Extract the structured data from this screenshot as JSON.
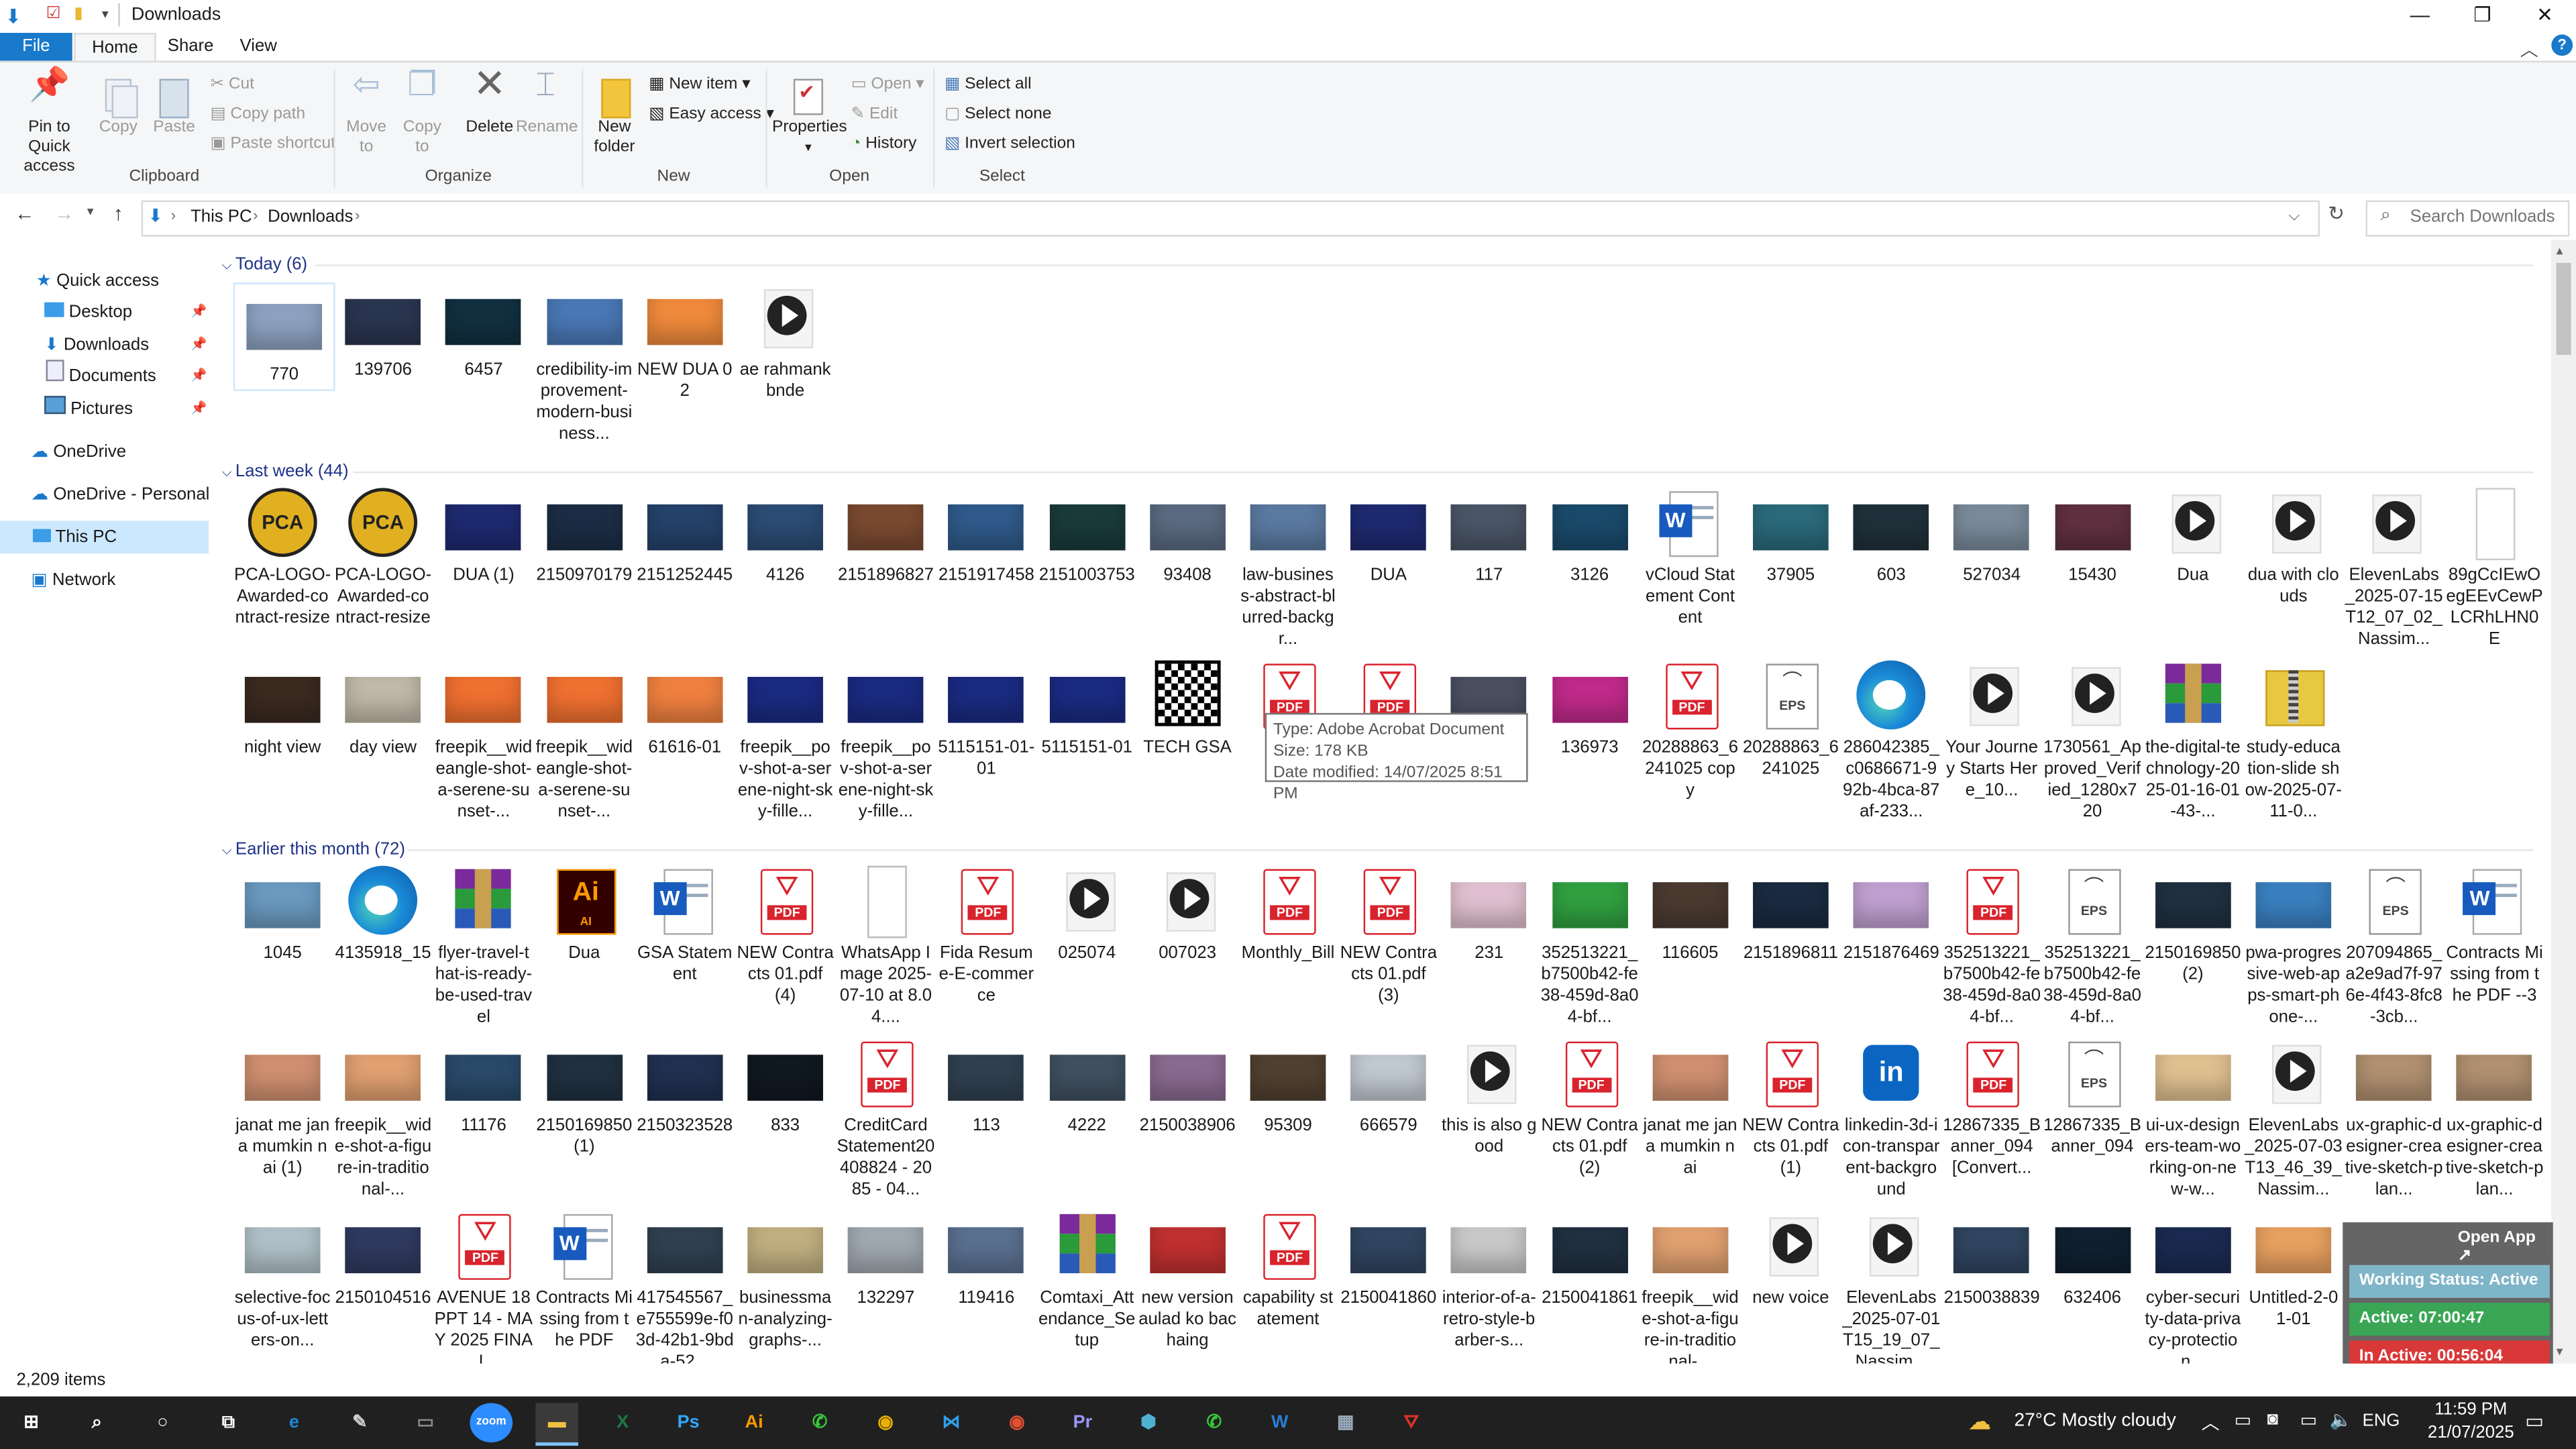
{
  "window": {
    "title": "Downloads",
    "minimize": "—",
    "maximize": "❐",
    "close": "✕"
  },
  "ribbon_tabs": [
    "File",
    "Home",
    "Share",
    "View"
  ],
  "ribbon": {
    "clipboard": {
      "label": "Clipboard",
      "pin": "Pin to Quick access",
      "copy": "Copy",
      "paste": "Paste",
      "cut": "Cut",
      "copy_path": "Copy path",
      "paste_shortcut": "Paste shortcut"
    },
    "organize": {
      "label": "Organize",
      "move_to": "Move to",
      "copy_to": "Copy to",
      "delete": "Delete",
      "rename": "Rename"
    },
    "new": {
      "label": "New",
      "new_folder": "New folder",
      "new_item": "New item",
      "easy_access": "Easy access"
    },
    "open": {
      "label": "Open",
      "properties": "Properties",
      "open": "Open",
      "edit": "Edit",
      "history": "History"
    },
    "select": {
      "label": "Select",
      "select_all": "Select all",
      "select_none": "Select none",
      "invert_selection": "Invert selection"
    }
  },
  "address": {
    "crumbs": [
      "This PC",
      "Downloads"
    ],
    "search_placeholder": "Search Downloads"
  },
  "nav": {
    "quick_access": "Quick access",
    "desktop": "Desktop",
    "downloads": "Downloads",
    "documents": "Documents",
    "pictures": "Pictures",
    "onedrive": "OneDrive",
    "onedrive_personal": "OneDrive - Personal",
    "this_pc": "This PC",
    "network": "Network"
  },
  "groups": {
    "today": "Today (6)",
    "last_week": "Last week (44)",
    "earlier": "Earlier this month (72)"
  },
  "files_today": [
    {
      "name": "770",
      "type": "photo",
      "color": "#8da2c0"
    },
    {
      "name": "139706",
      "type": "photo",
      "color": "#2a3550"
    },
    {
      "name": "6457",
      "type": "photo",
      "color": "#123040"
    },
    {
      "name": "credibility-improvement-modern-business...",
      "type": "photo",
      "color": "#4a78b5"
    },
    {
      "name": "NEW DUA 02",
      "type": "photo",
      "color": "#f08a3c"
    },
    {
      "name": "ae rahmank bnde",
      "type": "video",
      "color": "#333333"
    }
  ],
  "files_week_row1": [
    {
      "name": "PCA-LOGO-Awarded-contract-resize",
      "type": "pca",
      "color": "#e0b020"
    },
    {
      "name": "PCA-LOGO-Awarded-contract-resize",
      "type": "pca",
      "color": "#e0b020"
    },
    {
      "name": "DUA (1)",
      "type": "photo",
      "color": "#1e2a70"
    },
    {
      "name": "2150970179",
      "type": "photo",
      "color": "#1b2d45"
    },
    {
      "name": "2151252445",
      "type": "photo",
      "color": "#25426a"
    },
    {
      "name": "4126",
      "type": "photo",
      "color": "#2b4c74"
    },
    {
      "name": "2151896827",
      "type": "photo",
      "color": "#7a4a30"
    },
    {
      "name": "2151917458",
      "type": "photo",
      "color": "#2f5a8a"
    },
    {
      "name": "2151003753",
      "type": "photo",
      "color": "#1a3a3a"
    },
    {
      "name": "93408",
      "type": "photo",
      "color": "#5a6a80"
    },
    {
      "name": "law-business-abstract-blurred-backgr...",
      "type": "photo",
      "color": "#5b7aa0"
    },
    {
      "name": "DUA",
      "type": "photo",
      "color": "#1e2a70"
    },
    {
      "name": "117",
      "type": "photo",
      "color": "#4a5566"
    },
    {
      "name": "3126",
      "type": "photo",
      "color": "#1a4a6a"
    },
    {
      "name": "vCloud Statement Content",
      "type": "word",
      "color": "#185abd"
    },
    {
      "name": "37905",
      "type": "photo",
      "color": "#2a6a7a"
    },
    {
      "name": "603",
      "type": "photo",
      "color": "#20303a"
    },
    {
      "name": "527034",
      "type": "photo",
      "color": "#7a8a9a"
    },
    {
      "name": "15430",
      "type": "photo",
      "color": "#603040"
    },
    {
      "name": "Dua",
      "type": "video",
      "color": "#333333"
    },
    {
      "name": "dua with clouds",
      "type": "video",
      "color": "#333333"
    },
    {
      "name": "ElevenLabs_2025-07-15T12_07_02_Nassim...",
      "type": "video",
      "color": "#333333"
    },
    {
      "name": "89gCcIEwOegEEvCewPLCRhLHN0E",
      "type": "doc",
      "color": "#cccccc"
    }
  ],
  "files_week_row2": [
    {
      "name": "night view",
      "type": "photo",
      "color": "#3a2a20"
    },
    {
      "name": "day view",
      "type": "photo",
      "color": "#c0b8a8"
    },
    {
      "name": "freepik__wideangle-shot-a-serene-sunset-...",
      "type": "photo",
      "color": "#f07030"
    },
    {
      "name": "freepik__wideangle-shot-a-serene-sunset-...",
      "type": "photo",
      "color": "#f07030"
    },
    {
      "name": "61616-01",
      "type": "photo",
      "color": "#f08040"
    },
    {
      "name": "freepik__pov-shot-a-serene-night-sky-fille...",
      "type": "photo",
      "color": "#1a2a80"
    },
    {
      "name": "freepik__pov-shot-a-serene-night-sky-fille...",
      "type": "photo",
      "color": "#1a2a80"
    },
    {
      "name": "5115151-01-01",
      "type": "photo",
      "color": "#1a2a80"
    },
    {
      "name": "5115151-01",
      "type": "photo",
      "color": "#1a2a80"
    },
    {
      "name": "TECH GSA",
      "type": "qr",
      "color": "#000000"
    },
    {
      "name": "",
      "type": "pdf",
      "color": "#d9232d"
    },
    {
      "name": "",
      "type": "pdf",
      "color": "#d9232d"
    },
    {
      "name": "",
      "type": "photo",
      "color": "#4a5060"
    },
    {
      "name": "136973",
      "type": "photo",
      "color": "#c02a8a"
    },
    {
      "name": "20288863_6241025 copy",
      "type": "pdf",
      "color": "#d9232d"
    },
    {
      "name": "20288863_6241025",
      "type": "eps",
      "color": "#666666"
    },
    {
      "name": "286042385_c0686671-992b-4bca-87af-233...",
      "type": "edge",
      "color": "#1a8ad8"
    },
    {
      "name": "Your Journey Starts Here_10...",
      "type": "video",
      "color": "#c03020"
    },
    {
      "name": "1730561_Approved_Verified_1280x720",
      "type": "video",
      "color": "#c0a070"
    },
    {
      "name": "the-digital-technology-2025-01-16-01-43-...",
      "type": "rar",
      "color": "#a03070"
    },
    {
      "name": "study-education-slide show-2025-07-11-0...",
      "type": "zip",
      "color": "#e8c840"
    }
  ],
  "files_earlier_row1": [
    {
      "name": "1045",
      "type": "photo",
      "color": "#6a9ac0"
    },
    {
      "name": "4135918_15",
      "type": "edge",
      "color": "#1a8ad8"
    },
    {
      "name": "flyer-travel-that-is-ready-be-used-travel",
      "type": "rar",
      "color": "#a03070"
    },
    {
      "name": "Dua",
      "type": "ai",
      "color": "#330000"
    },
    {
      "name": "GSA Statement",
      "type": "word",
      "color": "#185abd"
    },
    {
      "name": "NEW Contracts 01.pdf (4)",
      "type": "pdf",
      "color": "#d9232d"
    },
    {
      "name": "WhatsApp Image 2025-07-10 at 8.04....",
      "type": "doc",
      "color": "#bbbbbb"
    },
    {
      "name": "Fida Resume-E-commerce",
      "type": "pdf",
      "color": "#d9232d"
    },
    {
      "name": "025074",
      "type": "video",
      "color": "#333333"
    },
    {
      "name": "007023",
      "type": "video",
      "color": "#333333"
    },
    {
      "name": "Monthly_Bill",
      "type": "pdf",
      "color": "#d9232d"
    },
    {
      "name": "NEW Contracts 01.pdf (3)",
      "type": "pdf",
      "color": "#d9232d"
    },
    {
      "name": "231",
      "type": "photo",
      "color": "#e0c0d0"
    },
    {
      "name": "352513221_b7500b42-fe38-459d-8a04-bf...",
      "type": "photo",
      "color": "#30a040"
    },
    {
      "name": "116605",
      "type": "photo",
      "color": "#4a3a30"
    },
    {
      "name": "2151896811",
      "type": "photo",
      "color": "#1a2a40"
    },
    {
      "name": "2151876469",
      "type": "photo",
      "color": "#c0a0d0"
    },
    {
      "name": "352513221_b7500b42-fe38-459d-8a04-bf...",
      "type": "pdf",
      "color": "#d9232d"
    },
    {
      "name": "352513221_b7500b42-fe38-459d-8a04-bf...",
      "type": "eps",
      "color": "#666666"
    },
    {
      "name": "2150169850 (2)",
      "type": "photo",
      "color": "#203040"
    },
    {
      "name": "pwa-progressive-web-apps-smart-phone-...",
      "type": "photo",
      "color": "#3a80c0"
    },
    {
      "name": "207094865_a2e9ad7f-976e-4f43-8fc8-3cb...",
      "type": "eps",
      "color": "#666666"
    },
    {
      "name": "Contracts Missing from the PDF --3",
      "type": "word",
      "color": "#185abd"
    }
  ],
  "files_earlier_row2": [
    {
      "name": "janat me jana mumkin nai (1)",
      "type": "photo",
      "color": "#d09070"
    },
    {
      "name": "freepik__wide-shot-a-figure-in-traditional-...",
      "type": "photo",
      "color": "#e0a070"
    },
    {
      "name": "11176",
      "type": "photo",
      "color": "#2a4a6a"
    },
    {
      "name": "2150169850 (1)",
      "type": "photo",
      "color": "#203040"
    },
    {
      "name": "2150323528",
      "type": "photo",
      "color": "#203050"
    },
    {
      "name": "833",
      "type": "photo",
      "color": "#101820"
    },
    {
      "name": "CreditCard Statement20408824 - 2085 - 04...",
      "type": "pdf",
      "color": "#d9232d"
    },
    {
      "name": "113",
      "type": "photo",
      "color": "#304050"
    },
    {
      "name": "4222",
      "type": "photo",
      "color": "#405060"
    },
    {
      "name": "2150038906",
      "type": "photo",
      "color": "#8a6a90"
    },
    {
      "name": "95309",
      "type": "photo",
      "color": "#504030"
    },
    {
      "name": "666579",
      "type": "photo",
      "color": "#c0c8d0"
    },
    {
      "name": "this is also good",
      "type": "video",
      "color": "#333333"
    },
    {
      "name": "NEW Contracts 01.pdf (2)",
      "type": "pdf",
      "color": "#d9232d"
    },
    {
      "name": "janat me jana mumkin nai",
      "type": "photo",
      "color": "#d09070"
    },
    {
      "name": "NEW Contracts 01.pdf (1)",
      "type": "pdf",
      "color": "#d9232d"
    },
    {
      "name": "linkedin-3d-icon-transparent-background",
      "type": "linkedin",
      "color": "#0a66c2"
    },
    {
      "name": "12867335_Banner_094 [Convert...",
      "type": "pdf",
      "color": "#d9232d"
    },
    {
      "name": "12867335_Banner_094",
      "type": "eps",
      "color": "#666666"
    },
    {
      "name": "ui-ux-designers-team-working-on-new-w...",
      "type": "photo",
      "color": "#e0c090"
    },
    {
      "name": "ElevenLabs_2025-07-03T13_46_39_Nassim...",
      "type": "video",
      "color": "#333333"
    },
    {
      "name": "ux-graphic-designer-creative-sketch-plan...",
      "type": "photo",
      "color": "#b09070"
    },
    {
      "name": "ux-graphic-designer-creative-sketch-plan...",
      "type": "photo",
      "color": "#b09070"
    }
  ],
  "files_earlier_row3": [
    {
      "name": "selective-focus-of-ux-letters-on...",
      "type": "photo",
      "color": "#b0c0c8"
    },
    {
      "name": "2150104516",
      "type": "photo",
      "color": "#303a60"
    },
    {
      "name": "AVENUE 18 PPT 14 - MAY 2025 FINAL",
      "type": "pdf",
      "color": "#d9232d"
    },
    {
      "name": "Contracts Missing from the PDF",
      "type": "word",
      "color": "#185abd"
    },
    {
      "name": "417545567_e755599e-f03d-42b1-9bda-52...",
      "type": "photo",
      "color": "#304050"
    },
    {
      "name": "businessman-analyzing-graphs-...",
      "type": "photo",
      "color": "#c0b080"
    },
    {
      "name": "132297",
      "type": "photo",
      "color": "#a0a8b0"
    },
    {
      "name": "119416",
      "type": "photo",
      "color": "#5a7090"
    },
    {
      "name": "Comtaxi_Attendance_Setup",
      "type": "rar",
      "color": "#a03070"
    },
    {
      "name": "new version aulad ko bachaing",
      "type": "photo",
      "color": "#c03030"
    },
    {
      "name": "capability statement",
      "type": "pdf",
      "color": "#d9232d"
    },
    {
      "name": "2150041860",
      "type": "photo",
      "color": "#304560"
    },
    {
      "name": "interior-of-a-retro-style-barber-s...",
      "type": "photo",
      "color": "#c8c8c8"
    },
    {
      "name": "2150041861",
      "type": "photo",
      "color": "#203040"
    },
    {
      "name": "freepik__wide-shot-a-figure-in-traditional-...",
      "type": "photo",
      "color": "#e0a070"
    },
    {
      "name": "new voice",
      "type": "video",
      "color": "#333333"
    },
    {
      "name": "ElevenLabs_2025-07-01T15_19_07_Nassim...",
      "type": "video",
      "color": "#333333"
    },
    {
      "name": "2150038839",
      "type": "photo",
      "color": "#304560"
    },
    {
      "name": "632406",
      "type": "photo",
      "color": "#102030"
    },
    {
      "name": "cyber-security-data-privacy-protection...",
      "type": "photo",
      "color": "#1a2a50"
    },
    {
      "name": "Untitled-2-01-01",
      "type": "photo",
      "color": "#e8a060"
    }
  ],
  "tooltip": {
    "type": "Type: Adobe Acrobat Document",
    "size": "Size: 178 KB",
    "modified": "Date modified: 14/07/2025 8:51 PM"
  },
  "status": {
    "items": "2,209 items"
  },
  "widget": {
    "open_app": "Open App ↗",
    "working_status": "Working Status: Active",
    "active": "Active: 07:00:47",
    "inactive": "In Active: 00:56:04",
    "active_color": "#3aa655",
    "inactive_color": "#d93838",
    "status_color": "#7fb5c8"
  },
  "taskbar": {
    "weather": "27°C  Mostly cloudy",
    "lang": "ENG",
    "time": "11:59 PM",
    "date": "21/07/2025",
    "apps": [
      {
        "icon": "windows-start-icon",
        "glyph": "⊞",
        "color": "#ffffff"
      },
      {
        "icon": "search-icon",
        "glyph": "⌕",
        "color": "#ffffff"
      },
      {
        "icon": "cortana-icon",
        "glyph": "○",
        "color": "#ffffff"
      },
      {
        "icon": "task-view-icon",
        "glyph": "⧉",
        "color": "#ffffff"
      },
      {
        "icon": "edge-icon",
        "glyph": "e",
        "color": "#1a8ad8"
      },
      {
        "icon": "pen-icon",
        "glyph": "✎",
        "color": "#cccccc"
      },
      {
        "icon": "terminal-icon",
        "glyph": "▭",
        "color": "#888888"
      },
      {
        "icon": "zoom-icon",
        "glyph": "zoom",
        "color": "#2d8cff"
      },
      {
        "icon": "file-explorer-icon",
        "glyph": "▬",
        "color": "#f0c040"
      },
      {
        "icon": "excel-icon",
        "glyph": "X",
        "color": "#1d7a45"
      },
      {
        "icon": "photoshop-icon",
        "glyph": "Ps",
        "color": "#31a8ff"
      },
      {
        "icon": "illustrator-icon",
        "glyph": "Ai",
        "color": "#ff9a00"
      },
      {
        "icon": "phone-app-icon",
        "glyph": "✆",
        "color": "#37c837"
      },
      {
        "icon": "chrome-icon",
        "glyph": "◉",
        "color": "#e8b000"
      },
      {
        "icon": "vscode-icon",
        "glyph": "⋈",
        "color": "#2f9ee9"
      },
      {
        "icon": "chrome-profile-icon",
        "glyph": "◉",
        "color": "#e05030"
      },
      {
        "icon": "premiere-icon",
        "glyph": "Pr",
        "color": "#9999ff"
      },
      {
        "icon": "app-hex-icon",
        "glyph": "⬢",
        "color": "#4fb0d0"
      },
      {
        "icon": "phone-app-2-icon",
        "glyph": "✆",
        "color": "#37c837"
      },
      {
        "icon": "word-icon",
        "glyph": "W",
        "color": "#2b7cd3"
      },
      {
        "icon": "calculator-icon",
        "glyph": "▦",
        "color": "#9ab"
      },
      {
        "icon": "acrobat-icon",
        "glyph": "⛛",
        "color": "#e0322c"
      }
    ]
  }
}
